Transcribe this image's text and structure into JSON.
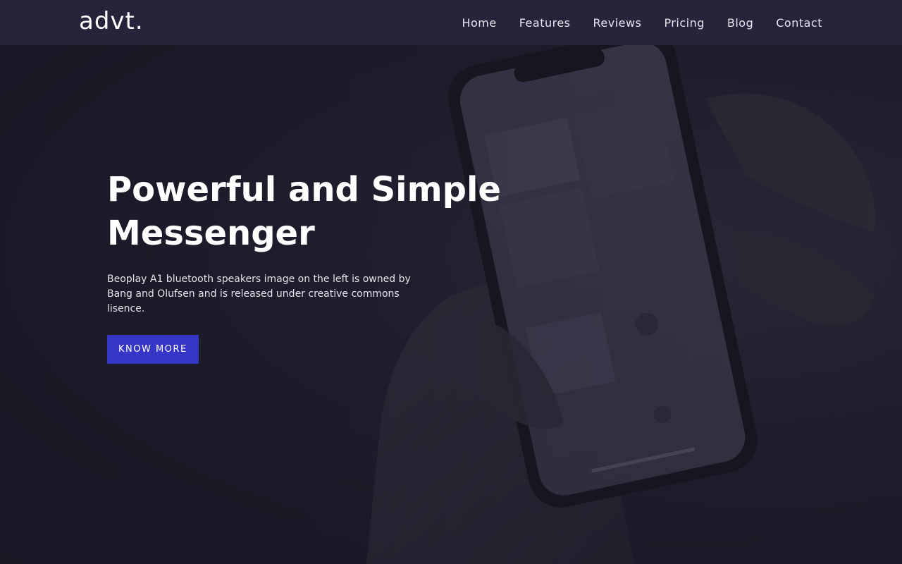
{
  "navbar": {
    "logo": "advt.",
    "links": [
      "Home",
      "Features",
      "Reviews",
      "Pricing",
      "Blog",
      "Contact"
    ]
  },
  "hero": {
    "title_line1": "Powerful and Simple",
    "title_line2": "Messenger",
    "description": "Beoplay A1 bluetooth speakers image on the left is owned by Bang and Olufsen and is released under creative commons lisence.",
    "cta_label": "KNOW MORE"
  },
  "colors": {
    "navbar_bg": "#25243a",
    "hero_bg": "#1f1e2c",
    "accent": "#3535c8",
    "text": "#ffffff"
  }
}
